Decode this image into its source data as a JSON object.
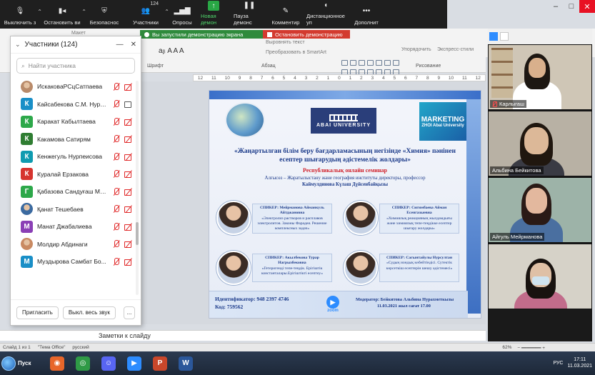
{
  "zoom_toolbar": {
    "items": [
      {
        "id": "mute",
        "label": "Выключить з",
        "icon": "microphone-icon"
      },
      {
        "id": "stop_video",
        "label": "Остановить ви",
        "icon": "video-camera-icon"
      },
      {
        "id": "security",
        "label": "Безопаснос",
        "icon": "shield-icon"
      },
      {
        "id": "participants",
        "label": "Участники",
        "icon": "people-icon",
        "badge": "124"
      },
      {
        "id": "polls",
        "label": "Опросы",
        "icon": "bar-chart-icon"
      },
      {
        "id": "new_share",
        "label": "Новая демон",
        "icon": "share-arrow-icon",
        "active": true
      },
      {
        "id": "pause_share",
        "label": "Пауза демонс",
        "icon": "pause-icon"
      },
      {
        "id": "annotate",
        "label": "Комментир",
        "icon": "pen-icon"
      },
      {
        "id": "remote_control",
        "label": "Дистанционное уп",
        "icon": "mouse-icon"
      },
      {
        "id": "more",
        "label": "Дополнит",
        "icon": "more-dots-icon"
      }
    ],
    "accent_color": "#4fd56b"
  },
  "share_banner": {
    "status_text": "Вы запустили демонстрацию экрана",
    "stop_label": "Остановить демонстрацию"
  },
  "ribbon": {
    "slide_button": "Макет",
    "font_section": "Шрифт",
    "paragraph_section": "Абзац",
    "drawing_section": "Рисование",
    "text_direction": "Выровнять текст",
    "smartart": "Преобразовать в SmartArt",
    "arrange": "Упорядочить",
    "quick_styles": "Экспресс-стили",
    "ruler_marks": [
      "12",
      "11",
      "10",
      "9",
      "8",
      "7",
      "6",
      "5",
      "4",
      "3",
      "2",
      "1",
      "0",
      "1",
      "2",
      "3",
      "4",
      "5",
      "6",
      "7",
      "8",
      "9",
      "10",
      "11",
      "12"
    ]
  },
  "participants_panel": {
    "title": "Участники (124)",
    "search_placeholder": "Найти участника",
    "invite_label": "Пригласить",
    "mute_all_label": "Выкл. весь звук",
    "more_label": "...",
    "rows": [
      {
        "name": "ИскаковаРСцСатпаева",
        "initial": "",
        "color": "#b98b6a",
        "video": "off",
        "photo": true
      },
      {
        "name": "Кайсабекова С.М. Нури...",
        "initial": "К",
        "color": "#1a8fc7",
        "video": "on"
      },
      {
        "name": "Каракат Кабылтаева",
        "initial": "К",
        "color": "#2da84a",
        "video": "off"
      },
      {
        "name": "Какамова Сатирям",
        "initial": "К",
        "color": "#2f7d32",
        "video": "off"
      },
      {
        "name": "Кенжегуль Нурпеисова",
        "initial": "К",
        "color": "#0f9bb0",
        "video": "off"
      },
      {
        "name": "Куралай Ерзакова",
        "initial": "К",
        "color": "#d6342f",
        "video": "off"
      },
      {
        "name": "Қабазова Сандуғаш Ма...",
        "initial": "Г",
        "color": "#2da84a",
        "video": "off"
      },
      {
        "name": "Қанат Тешебаев",
        "initial": "",
        "color": "#3b6aa0",
        "video": "off",
        "photo": true
      },
      {
        "name": "Манат Джабалиева",
        "initial": "М",
        "color": "#8a3fb5",
        "video": "off"
      },
      {
        "name": "Молдир Абдинаги",
        "initial": "",
        "color": "#c98a62",
        "video": "off",
        "photo": true
      },
      {
        "name": "Муздырова Самбат Бо...",
        "initial": "М",
        "color": "#1a8fc7",
        "video": "off"
      }
    ]
  },
  "slide": {
    "title": "«Жаңартылған білім беру бағдарламасының негізінде «Химия» пәнінен есептер шығарудың әдістемелік жолдары»",
    "subtitle": "Республикалық онлайн семинар",
    "org_prefix": "Алғысөз – Жаратылыстану және география институты директоры, профессор",
    "org_person": "Каймулдинова Күлаш Дүйсенбайқызы",
    "logo_abai": "ABAI UNIVERSITY",
    "logo_marketing": "MARKETING",
    "logo_marketing_sub": "ZHOI Abai University",
    "speakers": [
      {
        "role": "СПИКЕР:",
        "name": "Мейрманова Айманкуль Айтджановна",
        "topic": "«Электролиз растворов и расплавов электролитов. Законы Фарадея. Решение комплексных задач»"
      },
      {
        "role": "СПИКЕР:",
        "name": "Сигимбаева Айман Есенгазыевна",
        "topic": "«Химиялық реакцияның жылдамдығы және химиялық тепе-теңдікке есептер шығару жолдары»"
      },
      {
        "role": "СПИКЕР:",
        "name": "Акылбекова Турар Нагрызбековна",
        "topic": "«Гетерогенді тепе-теңдік. Ерігіштік константалары.Ерігіштікті есептеу»"
      },
      {
        "role": "СПИКЕР:",
        "name": "Сагынтайулы Нурсултан",
        "topic": "«Судың иондық көбейтіндісі. Сутектік көрсеткіш есептерін шешу әдістемесі»"
      }
    ],
    "conf_id": "Идентификатор: 948 2397 4746",
    "conf_code": "Код: 759562",
    "zoom_label": "zoom",
    "moderator": "Модератор: Бейкитова Альбина Нурахметкызы",
    "date_time": "11.03.2021 жыл сағат 17.00"
  },
  "notes_placeholder": "Заметки к слайду",
  "status_bar": {
    "slide_info": "Слайд 1 из 1",
    "theme": "\"Тема Office\"",
    "language": "русский",
    "zoom": "62%"
  },
  "video_tiles": [
    {
      "name": "Карлыгаш",
      "muted": true,
      "bg": "#cfc6b6"
    },
    {
      "name": "Альбина Бейкитова",
      "muted": false,
      "bg": "#b8b1a4"
    },
    {
      "name": "Айгуль Мейрманова",
      "muted": false,
      "bg": "#9db3a8"
    },
    {
      "name": "",
      "muted": false,
      "bg": "#d6d2c8"
    }
  ],
  "taskbar": {
    "start_label": "Пуск",
    "apps": [
      {
        "name": "firefox-icon",
        "color": "#e8662a",
        "glyph": "◉"
      },
      {
        "name": "chrome-icon",
        "color": "#2f9a46",
        "glyph": "◎"
      },
      {
        "name": "discord-icon",
        "color": "#5865f2",
        "glyph": "☺"
      },
      {
        "name": "zoom-app-icon",
        "color": "#2d8cff",
        "glyph": "▶"
      },
      {
        "name": "powerpoint-icon",
        "color": "#c9472b",
        "glyph": "P"
      },
      {
        "name": "word-icon",
        "color": "#2b579a",
        "glyph": "W"
      }
    ],
    "lang": "РУС",
    "time": "17:11",
    "date": "11.03.2021"
  }
}
